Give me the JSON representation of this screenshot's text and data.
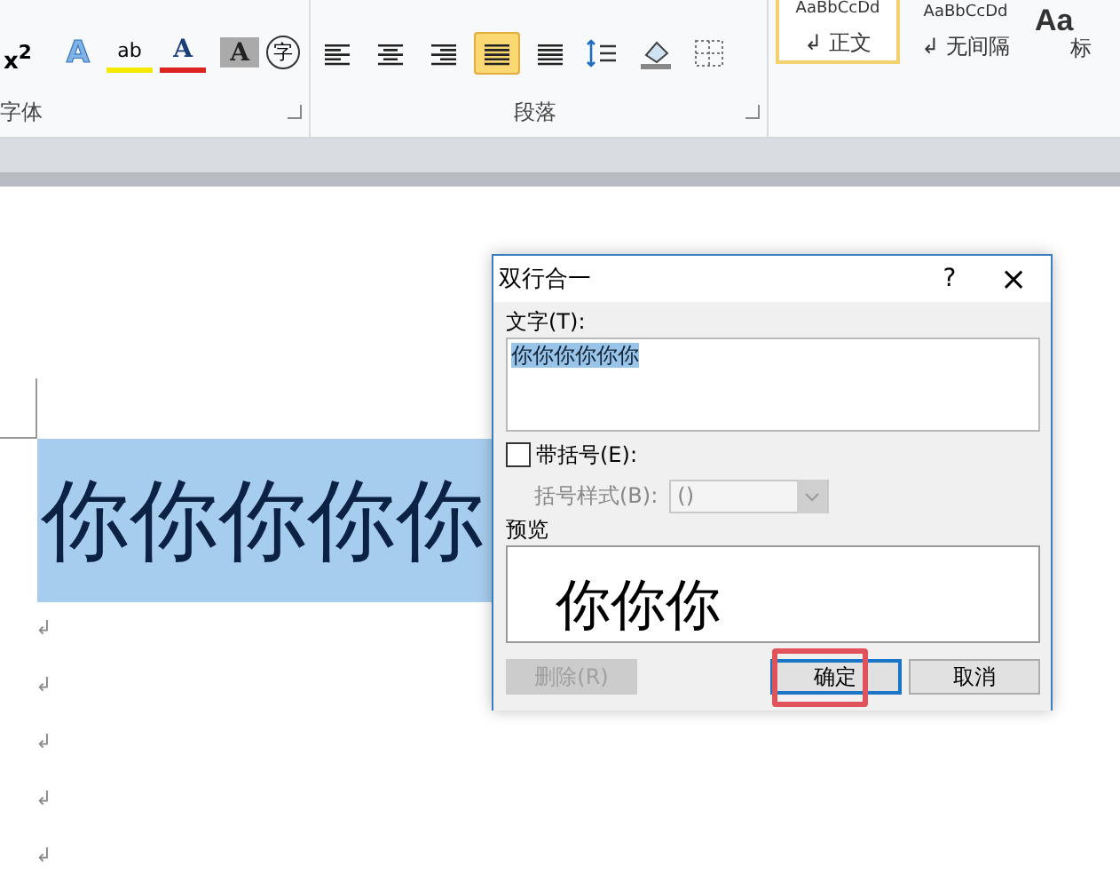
{
  "ribbon": {
    "font_group": {
      "label": "字体",
      "tools": [
        {
          "kind": "superscript",
          "glyph": "x$^{2}$"
        },
        {
          "kind": "text_effect",
          "glyph": "A"
        },
        {
          "kind": "highlight",
          "glyph": "ab"
        },
        {
          "kind": "font_color",
          "glyph": "A"
        },
        {
          "kind": "shading",
          "glyph": "A"
        },
        {
          "kind": "enclose",
          "glyph": "字"
        }
      ]
    },
    "paragraph_group": {
      "label": "段落",
      "tools": [
        {
          "kind": "align_left",
          "selected": false
        },
        {
          "kind": "align_center",
          "selected": false
        },
        {
          "kind": "align_right",
          "selected": false
        },
        {
          "kind": "justify",
          "selected": true
        },
        {
          "kind": "distribute",
          "selected": false
        },
        {
          "kind": "line_spacing",
          "selected": false
        },
        {
          "kind": "shading",
          "selected": false
        },
        {
          "kind": "borders",
          "selected": false
        }
      ]
    },
    "styles": [
      {
        "preview": "AaBbCcDd",
        "label": "↲ 正文",
        "selected": true
      },
      {
        "preview": "AaBbCcDd",
        "label": "↲ 无间隔",
        "selected": false
      },
      {
        "preview": "Aa",
        "label": "标",
        "selected": false
      }
    ]
  },
  "document": {
    "selected_text": "你你你你你",
    "paragraph_marks": [
      "↲",
      "↲",
      "↲",
      "↲",
      "↲"
    ]
  },
  "dialog": {
    "title": "双行合一",
    "help": "?",
    "close": "×",
    "text_label": "文字(T):",
    "text_value": "你你你你你你",
    "bracket_checkbox": {
      "label": "带括号(E):",
      "checked": false
    },
    "bracket_style": {
      "label": "括号样式(B):",
      "value": "()",
      "disabled": true
    },
    "preview_label": "预览",
    "preview_text": "你你你",
    "buttons": [
      {
        "label": "删除(R)",
        "disabled": true,
        "focused": false
      },
      {
        "label": "确定",
        "disabled": false,
        "focused": true
      },
      {
        "label": "取消",
        "disabled": false,
        "focused": false
      }
    ]
  }
}
